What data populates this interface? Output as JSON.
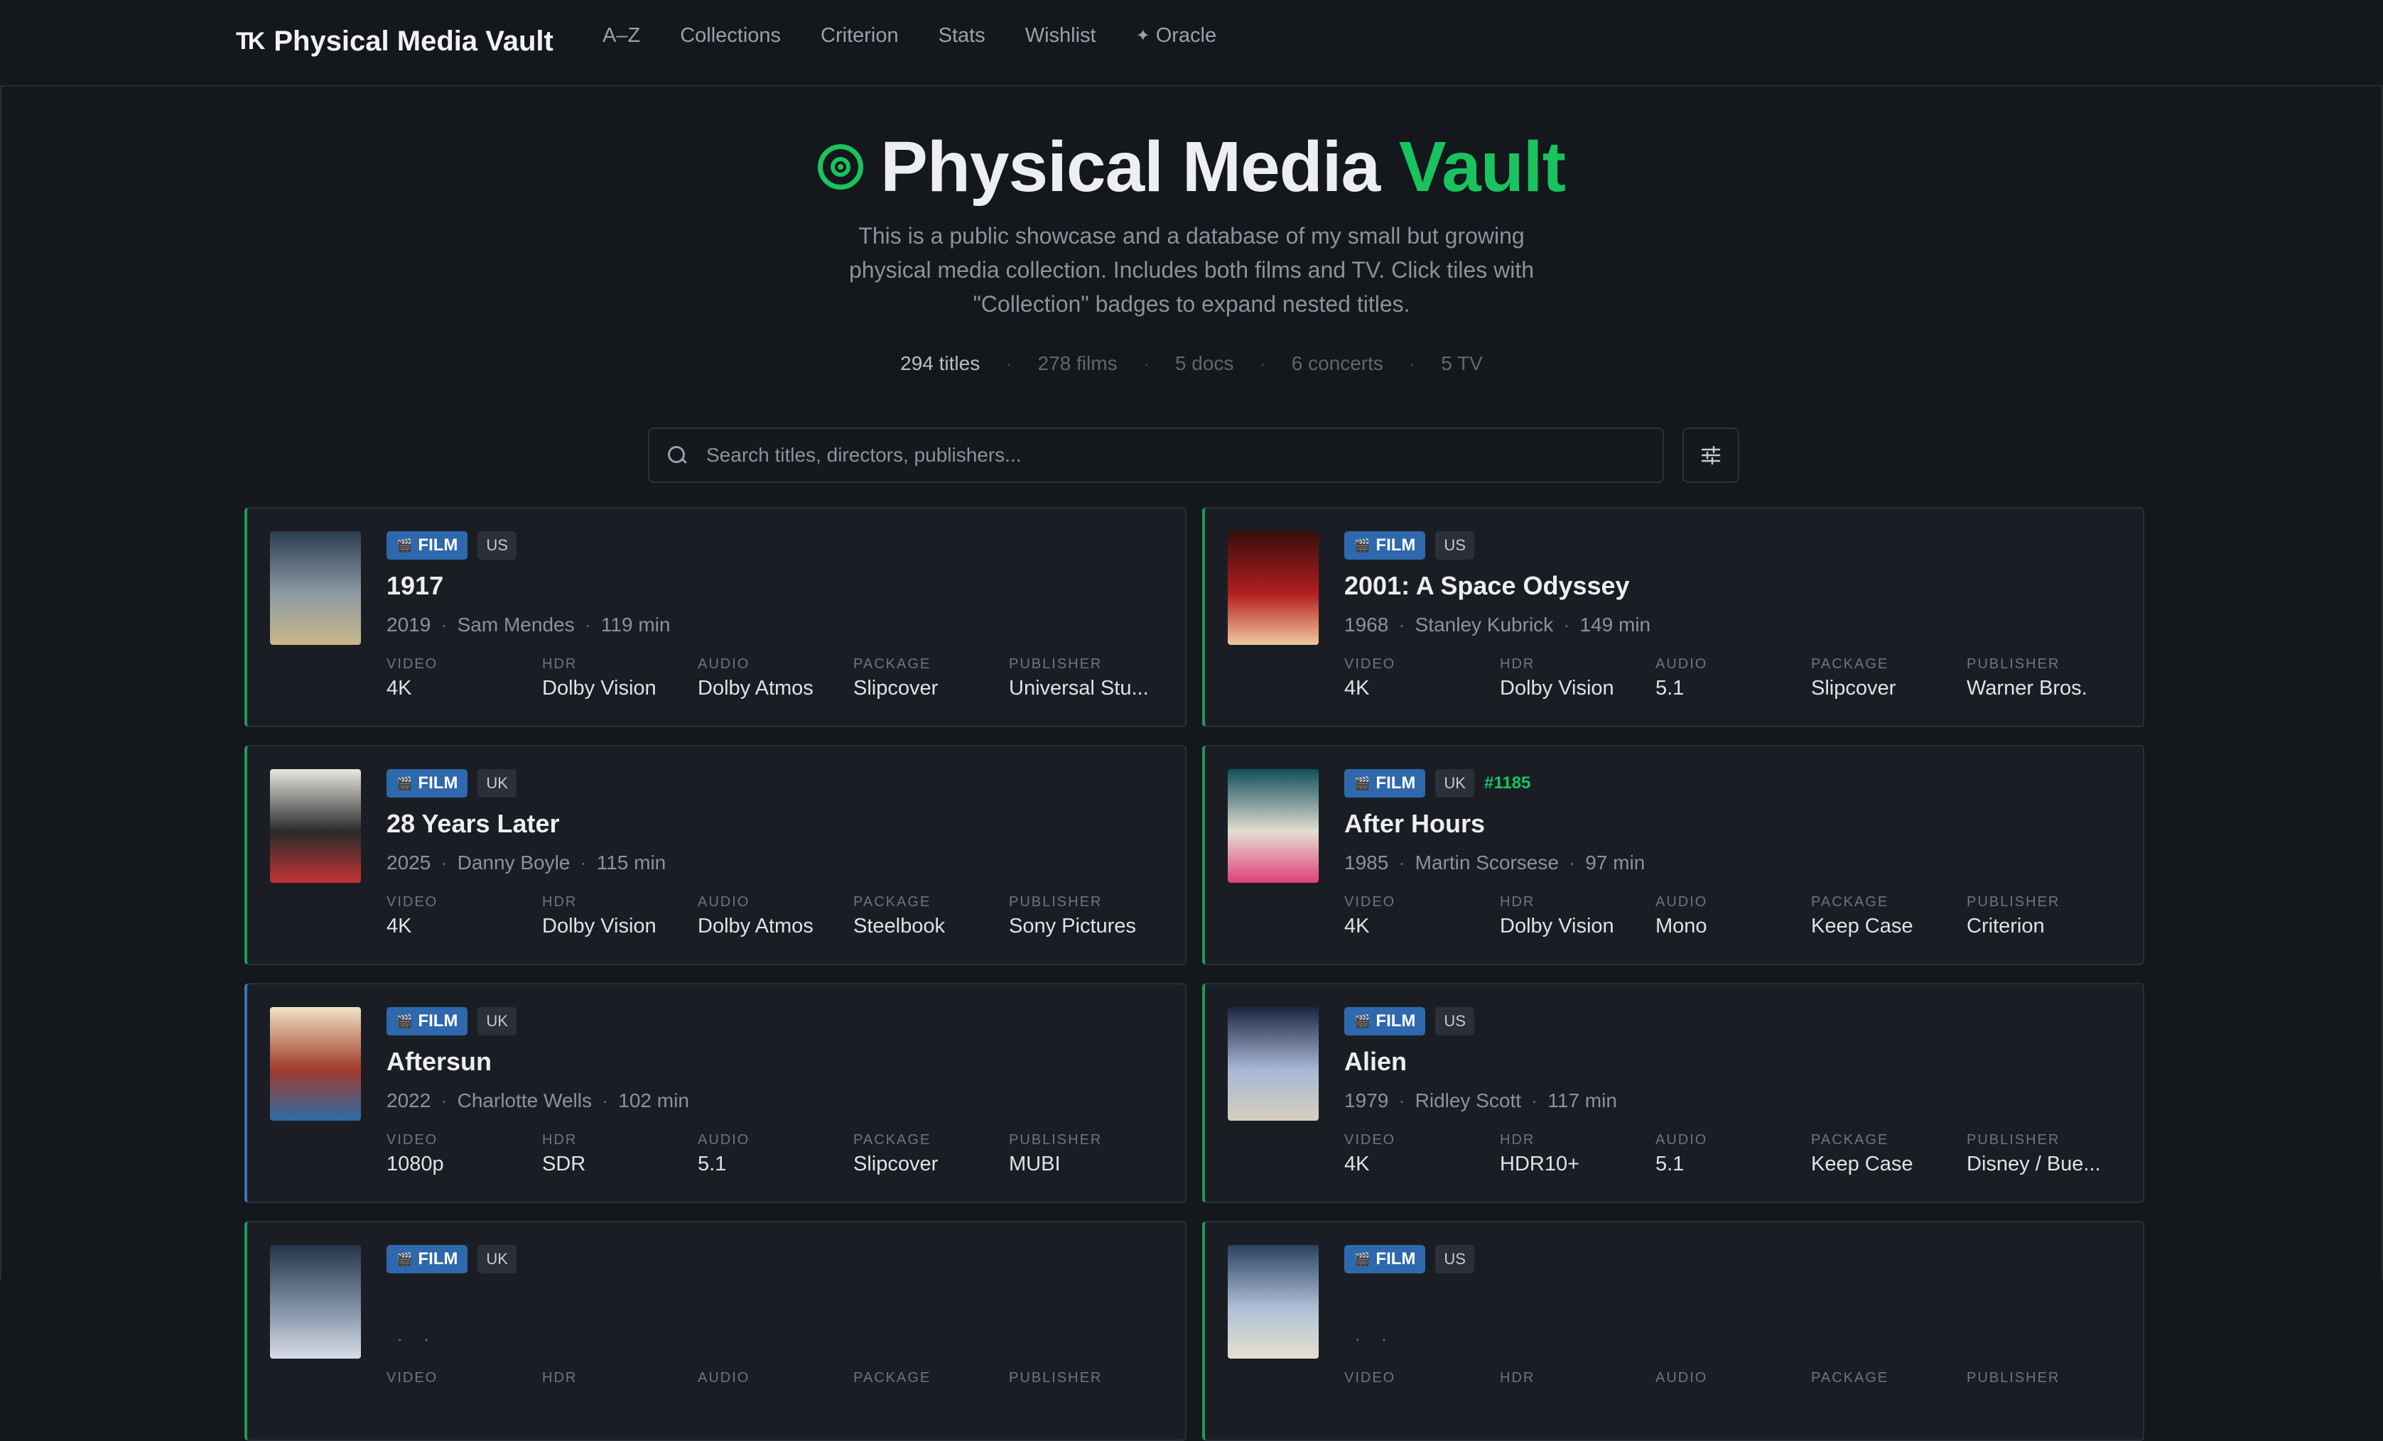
{
  "nav": {
    "logo_mark": "TK",
    "logo_text": "Physical Media Vault",
    "links": [
      "A–Z",
      "Collections",
      "Criterion",
      "Stats",
      "Wishlist",
      "Oracle"
    ]
  },
  "hero": {
    "title_main": "Physical Media ",
    "title_accent": "Vault",
    "description": "This is a public showcase and a database of my small but growing physical media collection. Includes both films and TV. Click tiles with \"Collection\" badges to expand nested titles.",
    "stats": [
      "294 titles",
      "278 films",
      "5 docs",
      "6 concerts",
      "5 TV"
    ]
  },
  "search": {
    "placeholder": "Search titles, directors, publishers..."
  },
  "spec_labels": [
    "VIDEO",
    "HDR",
    "AUDIO",
    "PACKAGE",
    "PUBLISHER"
  ],
  "cards": [
    {
      "type": "FILM",
      "region": "US",
      "number": "",
      "title": "1917",
      "year": "2019",
      "director": "Sam Mendes",
      "runtime": "119 min",
      "video": "4K",
      "hdr": "Dolby Vision",
      "audio": "Dolby Atmos",
      "package": "Slipcover",
      "publisher": "Universal Stu..."
    },
    {
      "type": "FILM",
      "region": "US",
      "number": "",
      "title": "2001: A Space Odyssey",
      "year": "1968",
      "director": "Stanley Kubrick",
      "runtime": "149 min",
      "video": "4K",
      "hdr": "Dolby Vision",
      "audio": "5.1",
      "package": "Slipcover",
      "publisher": "Warner Bros."
    },
    {
      "type": "FILM",
      "region": "UK",
      "number": "",
      "title": "28 Years Later",
      "year": "2025",
      "director": "Danny Boyle",
      "runtime": "115 min",
      "video": "4K",
      "hdr": "Dolby Vision",
      "audio": "Dolby Atmos",
      "package": "Steelbook",
      "publisher": "Sony Pictures"
    },
    {
      "type": "FILM",
      "region": "UK",
      "number": "#1185",
      "title": "After Hours",
      "year": "1985",
      "director": "Martin Scorsese",
      "runtime": "97 min",
      "video": "4K",
      "hdr": "Dolby Vision",
      "audio": "Mono",
      "package": "Keep Case",
      "publisher": "Criterion"
    },
    {
      "type": "FILM",
      "region": "UK",
      "number": "",
      "title": "Aftersun",
      "year": "2022",
      "director": "Charlotte Wells",
      "runtime": "102 min",
      "video": "1080p",
      "hdr": "SDR",
      "audio": "5.1",
      "package": "Slipcover",
      "publisher": "MUBI"
    },
    {
      "type": "FILM",
      "region": "US",
      "number": "",
      "title": "Alien",
      "year": "1979",
      "director": "Ridley Scott",
      "runtime": "117 min",
      "video": "4K",
      "hdr": "HDR10+",
      "audio": "5.1",
      "package": "Keep Case",
      "publisher": "Disney / Bue..."
    },
    {
      "type": "FILM",
      "region": "UK",
      "number": "",
      "title": "",
      "year": "",
      "director": "",
      "runtime": "",
      "video": "",
      "hdr": "",
      "audio": "",
      "package": "",
      "publisher": ""
    },
    {
      "type": "FILM",
      "region": "US",
      "number": "",
      "title": "",
      "year": "",
      "director": "",
      "runtime": "",
      "video": "",
      "hdr": "",
      "audio": "",
      "package": "",
      "publisher": ""
    }
  ]
}
